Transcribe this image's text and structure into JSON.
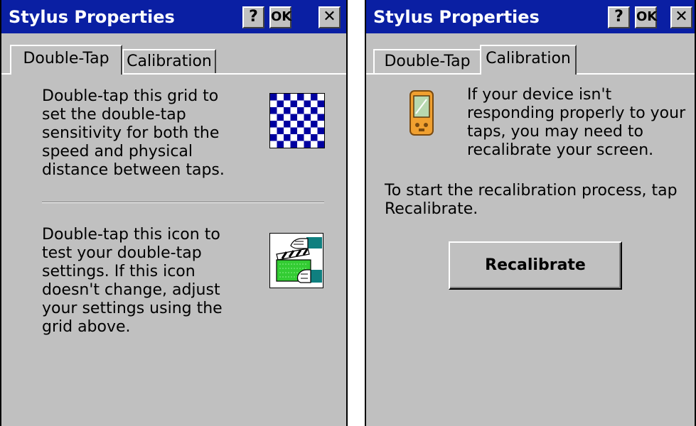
{
  "left_window": {
    "title": "Stylus Properties",
    "buttons": {
      "help": "?",
      "ok": "OK",
      "close": "✕"
    },
    "tabs": [
      {
        "label": "Double-Tap",
        "active": true
      },
      {
        "label": "Calibration",
        "active": false
      }
    ],
    "grid_text": [
      "Double-tap this grid to",
      "set the double-tap",
      "sensitivity for both the",
      "speed and physical",
      "distance between taps."
    ],
    "test_text": [
      "Double-tap this icon to",
      "test your double-tap",
      "settings. If this icon",
      "doesn't change, adjust",
      "your settings using the",
      "grid above."
    ],
    "icons": {
      "grid": "checkerboard-grid-icon",
      "test": "double-tap-test-icon"
    },
    "colors": {
      "titlebar": "#0a1fa3",
      "checker": "#0000a0"
    }
  },
  "right_window": {
    "title": "Stylus Properties",
    "buttons": {
      "help": "?",
      "ok": "OK",
      "close": "✕"
    },
    "tabs": [
      {
        "label": "Double-Tap",
        "active": false
      },
      {
        "label": "Calibration",
        "active": true
      }
    ],
    "intro_text": [
      "If your device isn't",
      "responding properly to your",
      "taps, you may need to",
      "recalibrate your screen."
    ],
    "instruction_text": [
      "To start the recalibration process, tap",
      "Recalibrate."
    ],
    "recalibrate_label": "Recalibrate",
    "icons": {
      "device": "pda-device-icon"
    }
  }
}
